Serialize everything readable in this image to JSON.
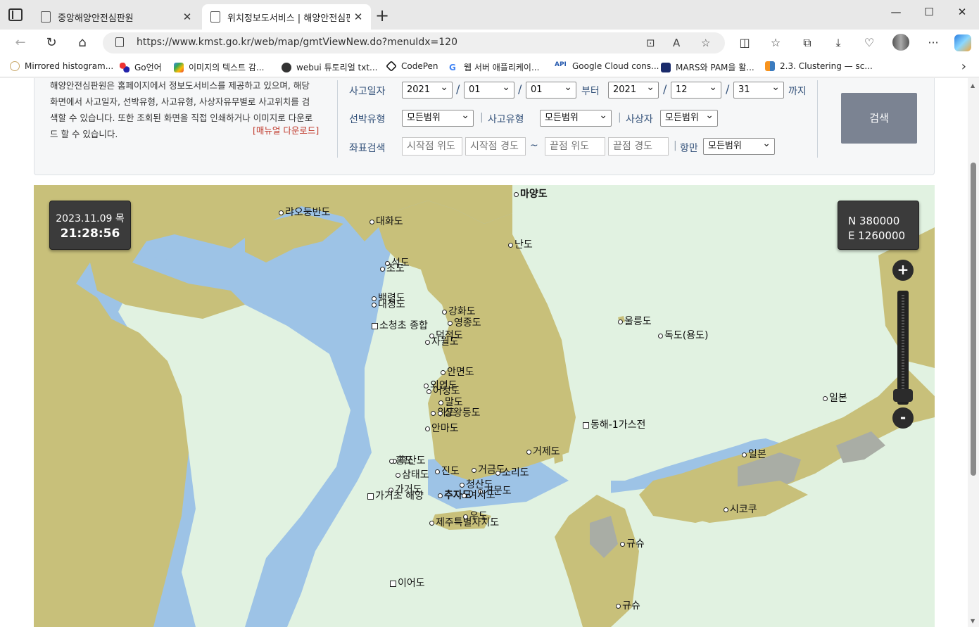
{
  "tabs": [
    {
      "title": "중앙해양안전심판원"
    },
    {
      "title": "위치정보도서비스 | 해양안전심판"
    }
  ],
  "address": {
    "url": "https://www.kmst.go.kr/web/map/gmtViewNew.do?menuIdx=120"
  },
  "bookmarks": [
    {
      "label": "Mirrored histogram..."
    },
    {
      "label": "Go언어"
    },
    {
      "label": "이미지의 텍스트 감..."
    },
    {
      "label": "webui 튜토리얼 txt..."
    },
    {
      "label": "CodePen"
    },
    {
      "label": "웹 서버 애플리케이..."
    },
    {
      "label": "Google Cloud cons..."
    },
    {
      "label": "MARS와 PAM을 활..."
    },
    {
      "label": "2.3. Clustering — sc..."
    }
  ],
  "intro": {
    "text": "해양안전심판원은 홈페이지에서 정보도서비스를 제공하고 있으며, 해당 화면에서 사고일자, 선박유형, 사고유형, 사상자유무별로 사고위치를 검색할 수 있습니다. 또한 조회된 화면을 직접 인쇄하거나 이미지로 다운로드 할 수 있습니다.",
    "manual_link": "[매뉴얼 다운로드]"
  },
  "form": {
    "date_label": "사고일자",
    "from_year": "2021",
    "from_month": "01",
    "from_day": "01",
    "from_suffix": "부터",
    "to_year": "2021",
    "to_month": "12",
    "to_day": "31",
    "to_suffix": "까지",
    "ship_label": "선박유형",
    "ship_value": "모든범위",
    "accident_label": "사고유형",
    "accident_value": "모든범위",
    "casualty_label": "사상자",
    "casualty_value": "모든범위",
    "coord_label": "좌표검색",
    "start_lat_ph": "시작점 위도",
    "start_lng_ph": "시작점 경도",
    "tilde": "~",
    "end_lat_ph": "끝점 위도",
    "end_lng_ph": "끝점 경도",
    "port_label": "항만",
    "port_value": "모든범위",
    "search_label": "검색"
  },
  "map": {
    "date": "2023.11.09 목",
    "time": "21:28:56",
    "coord_n": "N 380000",
    "coord_e": "E 1260000",
    "zoom_in": "+",
    "zoom_out": "-",
    "labels": [
      {
        "name": "마양도"
      },
      {
        "name": "랴오둥반도"
      },
      {
        "name": "대화도"
      },
      {
        "name": "난도"
      },
      {
        "name": "석도"
      },
      {
        "name": "초도"
      },
      {
        "name": "백령도"
      },
      {
        "name": "대청도"
      },
      {
        "name": "강화도"
      },
      {
        "name": "영종도"
      },
      {
        "name": "소청초 종합"
      },
      {
        "name": "덕적도"
      },
      {
        "name": "자월도"
      },
      {
        "name": "울릉도"
      },
      {
        "name": "독도(용도)"
      },
      {
        "name": "안면도"
      },
      {
        "name": "외연도"
      },
      {
        "name": "어청도"
      },
      {
        "name": "말도"
      },
      {
        "name": "위도"
      },
      {
        "name": "상왕등도"
      },
      {
        "name": "안마도"
      },
      {
        "name": "일본"
      },
      {
        "name": "동해-1가스전"
      },
      {
        "name": "거제도"
      },
      {
        "name": "흑산도"
      },
      {
        "name": "홍도"
      },
      {
        "name": "삼태도"
      },
      {
        "name": "진도"
      },
      {
        "name": "거금도"
      },
      {
        "name": "소리도"
      },
      {
        "name": "일본"
      },
      {
        "name": "가거도"
      },
      {
        "name": "가거초 해양"
      },
      {
        "name": "추자도"
      },
      {
        "name": "청산도"
      },
      {
        "name": "거문도"
      },
      {
        "name": "여서도"
      },
      {
        "name": "우도"
      },
      {
        "name": "제주특별자치도"
      },
      {
        "name": "시코쿠"
      },
      {
        "name": "규슈"
      },
      {
        "name": "이어도"
      },
      {
        "name": "규슈"
      }
    ]
  },
  "colors": {
    "land": "#c8c07a",
    "sea": "#e1f2e1",
    "shallow": "#9dc3e6",
    "japan_gray": "#a9ada5"
  }
}
